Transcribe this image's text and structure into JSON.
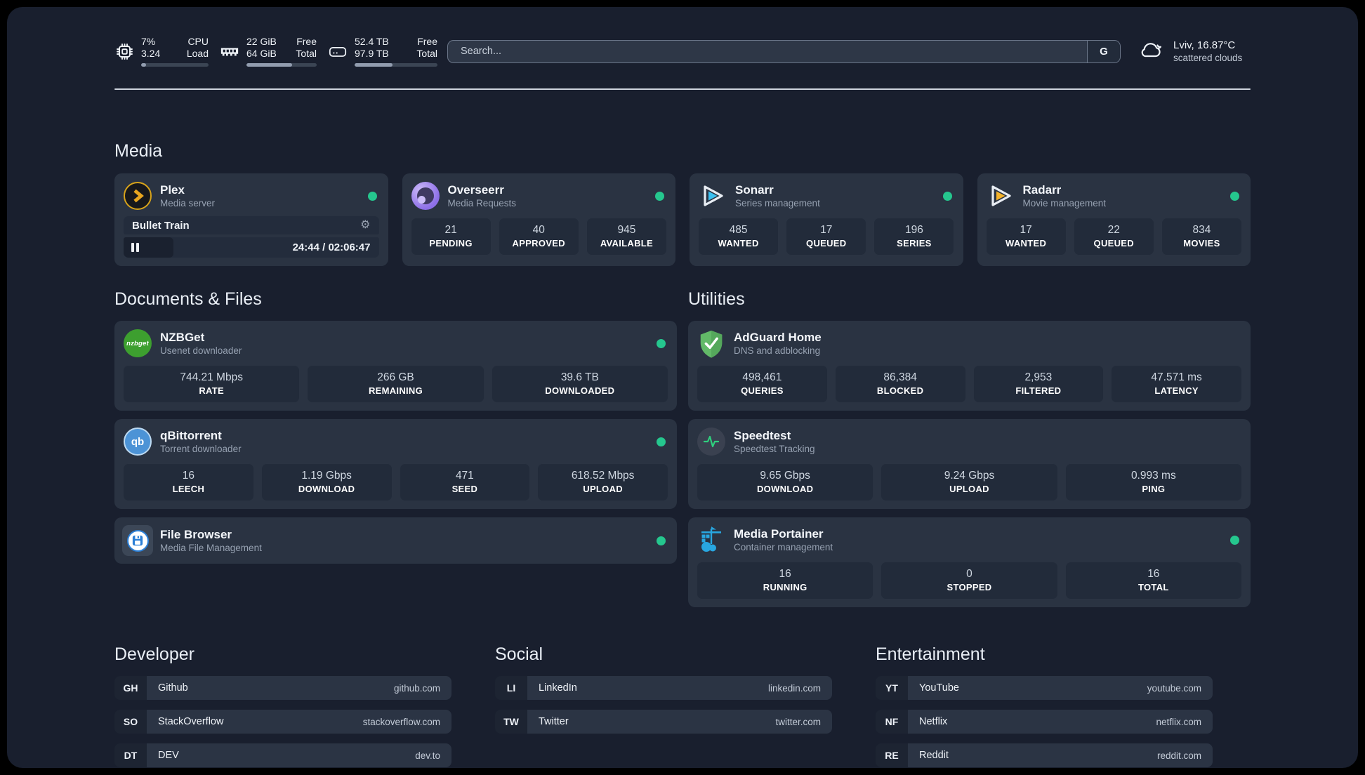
{
  "colors": {
    "background": "#191f2e",
    "card": "#2a3342",
    "tile": "#222b3a",
    "status_online": "#25c78e",
    "plex_amber": "#d8a31a",
    "divider": "#dde4ed"
  },
  "system": {
    "cpu": {
      "value_top": "7%",
      "value_bottom": "3.24",
      "label_top": "CPU",
      "label_bottom": "Load",
      "progress_pct": 7
    },
    "memory": {
      "value_top": "22 GiB",
      "value_bottom": "64 GiB",
      "label_top": "Free",
      "label_bottom": "Total",
      "progress_pct": 65
    },
    "storage": {
      "value_top": "52.4 TB",
      "value_bottom": "97.9 TB",
      "label_top": "Free",
      "label_bottom": "Total",
      "progress_pct": 46
    }
  },
  "search": {
    "placeholder": "Search...",
    "engine_button": "G"
  },
  "weather": {
    "location_temp": "Lviv, 16.87°C",
    "condition": "scattered clouds"
  },
  "icons": {
    "settings_gear": "⚙"
  },
  "sections": {
    "media": {
      "title": "Media",
      "cards": {
        "plex": {
          "title": "Plex",
          "subtitle": "Media server",
          "online": true,
          "now_playing": {
            "title": "Bullet Train",
            "time_display": "24:44 / 02:06:47",
            "progress_pct": 19.5
          }
        },
        "overseerr": {
          "title": "Overseerr",
          "subtitle": "Media Requests",
          "online": true,
          "stats": [
            {
              "value": "21",
              "label": "PENDING"
            },
            {
              "value": "40",
              "label": "APPROVED"
            },
            {
              "value": "945",
              "label": "AVAILABLE"
            }
          ]
        },
        "sonarr": {
          "title": "Sonarr",
          "subtitle": "Series management",
          "online": true,
          "stats": [
            {
              "value": "485",
              "label": "WANTED"
            },
            {
              "value": "17",
              "label": "QUEUED"
            },
            {
              "value": "196",
              "label": "SERIES"
            }
          ]
        },
        "radarr": {
          "title": "Radarr",
          "subtitle": "Movie management",
          "online": true,
          "stats": [
            {
              "value": "17",
              "label": "WANTED"
            },
            {
              "value": "22",
              "label": "QUEUED"
            },
            {
              "value": "834",
              "label": "MOVIES"
            }
          ]
        }
      }
    },
    "documents": {
      "title": "Documents & Files",
      "cards": {
        "nzbget": {
          "title": "NZBGet",
          "subtitle": "Usenet downloader",
          "online": true,
          "icon_text": "nzbget",
          "stats": [
            {
              "value": "744.21 Mbps",
              "label": "RATE"
            },
            {
              "value": "266 GB",
              "label": "REMAINING"
            },
            {
              "value": "39.6 TB",
              "label": "DOWNLOADED"
            }
          ]
        },
        "qbittorrent": {
          "title": "qBittorrent",
          "subtitle": "Torrent downloader",
          "online": true,
          "icon_text": "qb",
          "stats": [
            {
              "value": "16",
              "label": "LEECH"
            },
            {
              "value": "1.19 Gbps",
              "label": "DOWNLOAD"
            },
            {
              "value": "471",
              "label": "SEED"
            },
            {
              "value": "618.52 Mbps",
              "label": "UPLOAD"
            }
          ]
        },
        "filebrowser": {
          "title": "File Browser",
          "subtitle": "Media File Management",
          "online": true
        }
      }
    },
    "utilities": {
      "title": "Utilities",
      "cards": {
        "adguard": {
          "title": "AdGuard Home",
          "subtitle": "DNS and adblocking",
          "stats": [
            {
              "value": "498,461",
              "label": "QUERIES"
            },
            {
              "value": "86,384",
              "label": "BLOCKED"
            },
            {
              "value": "2,953",
              "label": "FILTERED"
            },
            {
              "value": "47.571 ms",
              "label": "LATENCY"
            }
          ]
        },
        "speedtest": {
          "title": "Speedtest",
          "subtitle": "Speedtest Tracking",
          "stats": [
            {
              "value": "9.65 Gbps",
              "label": "DOWNLOAD"
            },
            {
              "value": "9.24 Gbps",
              "label": "UPLOAD"
            },
            {
              "value": "0.993 ms",
              "label": "PING"
            }
          ]
        },
        "portainer": {
          "title": "Media Portainer",
          "subtitle": "Container management",
          "online": true,
          "stats": [
            {
              "value": "16",
              "label": "RUNNING"
            },
            {
              "value": "0",
              "label": "STOPPED"
            },
            {
              "value": "16",
              "label": "TOTAL"
            }
          ]
        }
      }
    }
  },
  "bookmarks": {
    "developer": {
      "title": "Developer",
      "items": [
        {
          "abbr": "GH",
          "name": "Github",
          "url": "github.com"
        },
        {
          "abbr": "SO",
          "name": "StackOverflow",
          "url": "stackoverflow.com"
        },
        {
          "abbr": "DT",
          "name": "DEV",
          "url": "dev.to"
        }
      ]
    },
    "social": {
      "title": "Social",
      "items": [
        {
          "abbr": "LI",
          "name": "LinkedIn",
          "url": "linkedin.com"
        },
        {
          "abbr": "TW",
          "name": "Twitter",
          "url": "twitter.com"
        }
      ]
    },
    "entertainment": {
      "title": "Entertainment",
      "items": [
        {
          "abbr": "YT",
          "name": "YouTube",
          "url": "youtube.com"
        },
        {
          "abbr": "NF",
          "name": "Netflix",
          "url": "netflix.com"
        },
        {
          "abbr": "RE",
          "name": "Reddit",
          "url": "reddit.com"
        }
      ]
    }
  }
}
